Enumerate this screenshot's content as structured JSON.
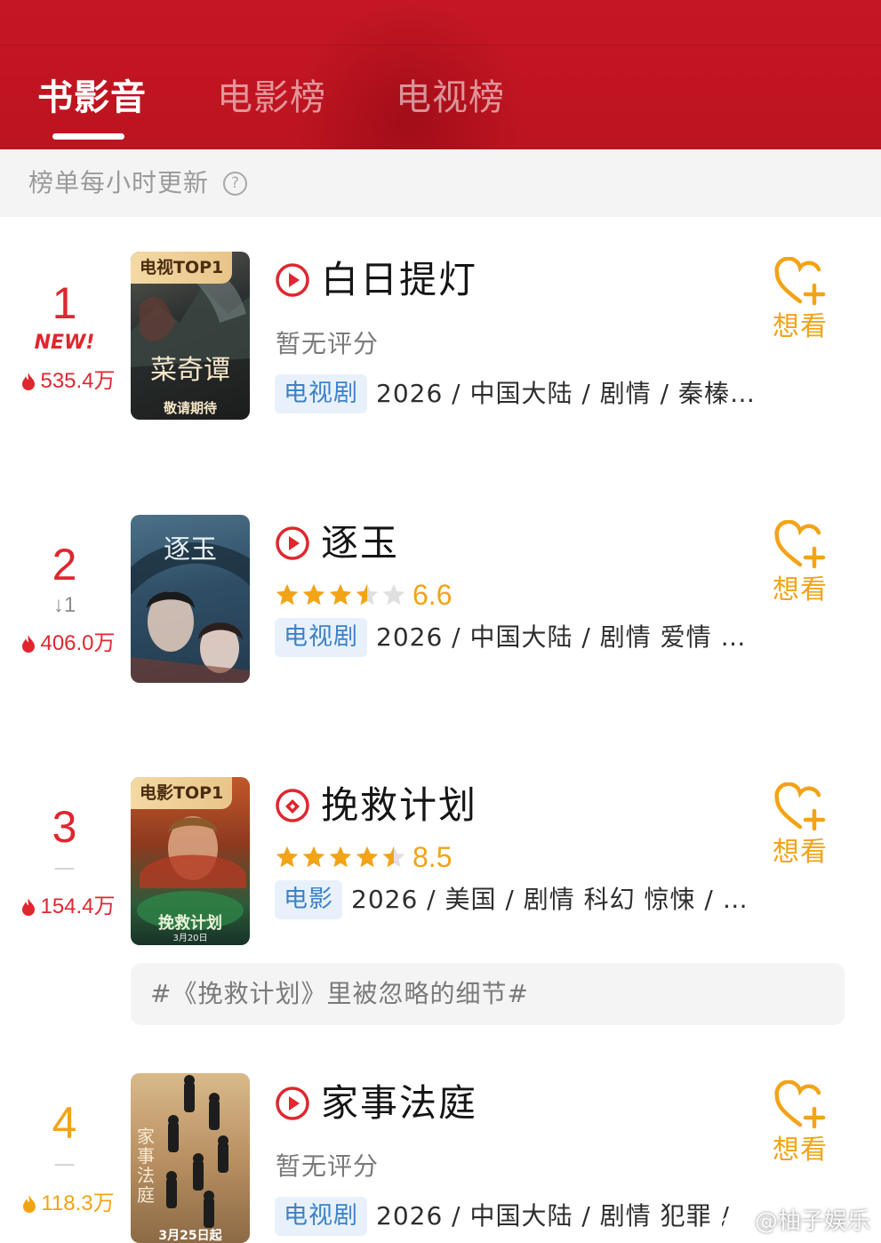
{
  "tabs": [
    {
      "label": "书影音"
    },
    {
      "label": "电影榜"
    },
    {
      "label": "电视榜"
    }
  ],
  "notice": {
    "text": "榜单每小时更新",
    "help_icon": "?"
  },
  "items": [
    {
      "rank": "1",
      "rank_change": "NEW!",
      "heat": "535.4万",
      "poster_badge": "电视TOP1",
      "poster_text": "敬请期待",
      "poster_logo": "菜奇谭",
      "title": "白日提灯",
      "rating_text": "暂无评分",
      "type": "电视剧",
      "meta": "2026 / 中国大陆 / 剧情 / 秦榛…",
      "want_label": "想看",
      "icon": "play-icon"
    },
    {
      "rank": "2",
      "rank_change": "↓1",
      "heat": "406.0万",
      "poster_logo": "逐玉",
      "title": "逐玉",
      "score": "6.6",
      "stars": 3.5,
      "type": "电视剧",
      "meta": "2026 / 中国大陆 / 剧情 爱情 …",
      "want_label": "想看",
      "icon": "play-icon"
    },
    {
      "rank": "3",
      "rank_change": "—",
      "heat": "154.4万",
      "poster_badge": "电影TOP1",
      "poster_text": "挽救计划",
      "poster_date": "3月20日",
      "title": "挽救计划",
      "score": "8.5",
      "stars": 4.5,
      "type": "电影",
      "meta": "2026 / 美国 / 剧情 科幻 惊悚 / …",
      "want_label": "想看",
      "icon": "ticket-icon"
    },
    {
      "rank": "4",
      "rank_change": "—",
      "heat": "118.3万",
      "poster_text": "3月25日起",
      "poster_logo": "家事法庭",
      "title": "家事法庭",
      "rating_text": "暂无评分",
      "type": "电视剧",
      "meta": "2026 / 中国大陆 / 剧情 犯罪 /",
      "want_label": "想看",
      "icon": "play-icon"
    }
  ],
  "topic": {
    "text": "#《挽救计划》里被忽略的细节#"
  },
  "watermark": {
    "text": "@柚子娱乐"
  },
  "colors": {
    "header_red": "#c41723",
    "rank_red": "#e0262f",
    "rank_orange": "#f2a316",
    "tag_blue": "#3c82c9",
    "tag_bg": "#e8f1fb",
    "star_gold": "#f2a316"
  }
}
